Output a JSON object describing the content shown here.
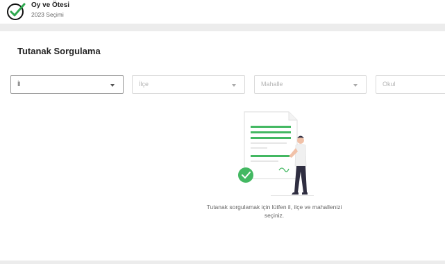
{
  "header": {
    "app_title": "Oy ve Ötesi",
    "app_subtitle": "2023 Seçimi",
    "logo_icon": "check-circle-logo-icon"
  },
  "page": {
    "title": "Tutanak Sorgulama"
  },
  "filters": {
    "il": {
      "value": "İl",
      "icon": "chevron-down-icon"
    },
    "ilce": {
      "placeholder": "İlçe",
      "icon": "chevron-down-icon"
    },
    "mahalle": {
      "placeholder": "Mahalle",
      "icon": "chevron-down-icon"
    },
    "okul": {
      "placeholder": "Okul"
    }
  },
  "empty_state": {
    "illustration_icon": "document-person-illustration",
    "message": "Tutanak sorgulamak için lütfen il, ilçe ve mahallenizi seçiniz."
  },
  "colors": {
    "accent": "#43b862",
    "text_dark": "#222222",
    "border": "#d9d9d9"
  }
}
